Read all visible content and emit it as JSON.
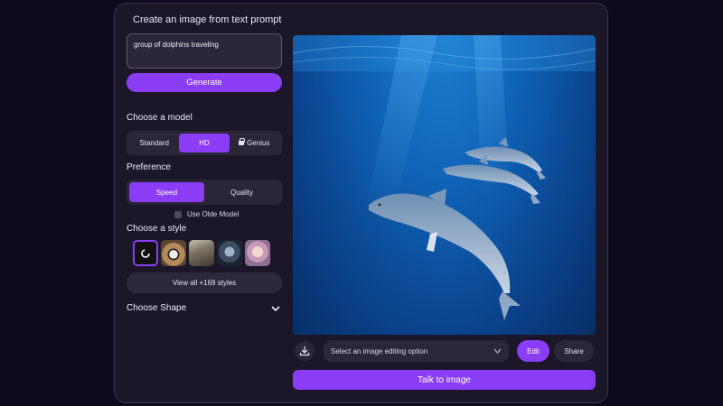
{
  "header": {
    "title": "Create an image from text prompt"
  },
  "prompt": {
    "value": "group of dolphins traveling"
  },
  "generate_label": "Generate",
  "model": {
    "label": "Choose a model",
    "options": [
      {
        "label": "Standard",
        "active": false
      },
      {
        "label": "HD",
        "active": true
      },
      {
        "label": "Genius",
        "active": false,
        "icon": "lock-icon"
      }
    ]
  },
  "preference": {
    "label": "Preference",
    "options": [
      {
        "label": "Speed",
        "active": true
      },
      {
        "label": "Quality",
        "active": false
      }
    ],
    "old_model_label": "Use Olde Model"
  },
  "style": {
    "label": "Choose a style",
    "view_all_label": "View all +169 styles",
    "thumbnails": [
      "no-style-icon",
      "panda",
      "warrior",
      "robot",
      "girl"
    ]
  },
  "shape": {
    "label": "Choose Shape"
  },
  "editor": {
    "select_placeholder": "Select an image editing option",
    "edit_label": "Edit",
    "share_label": "Share",
    "talk_label": "Talk to image"
  },
  "colors": {
    "accent": "#8b3df5",
    "panel": "#1b1728",
    "background": "#0d0a1e"
  }
}
